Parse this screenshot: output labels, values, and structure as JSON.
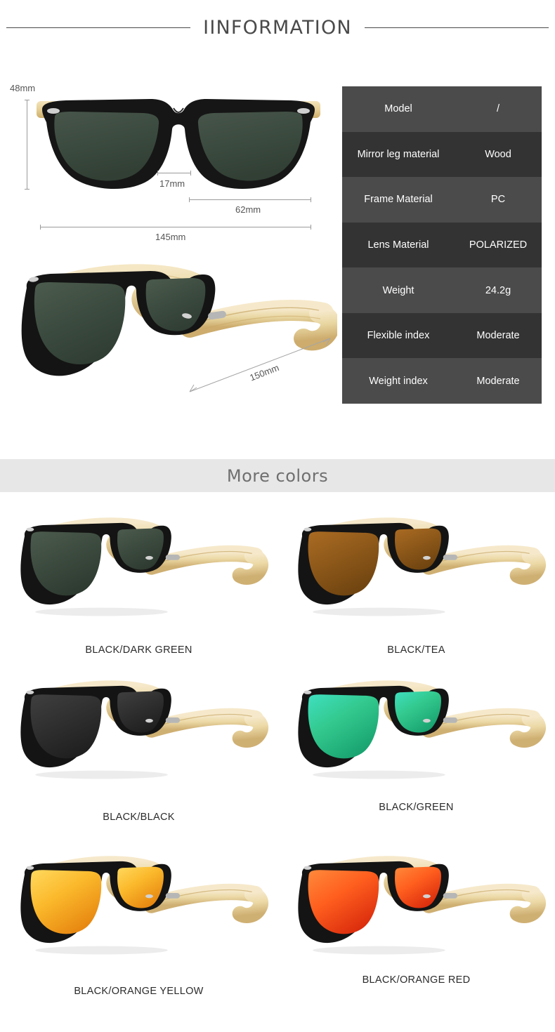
{
  "header": {
    "title": "IINFORMATION"
  },
  "spec_table": {
    "rows": [
      {
        "key": "Model",
        "value": "/"
      },
      {
        "key": "Mirror leg material",
        "value": "Wood"
      },
      {
        "key": "Frame Material",
        "value": "PC"
      },
      {
        "key": "Lens Material",
        "value": "POLARIZED"
      },
      {
        "key": "Weight",
        "value": "24.2g"
      },
      {
        "key": "Flexible index",
        "value": "Moderate"
      },
      {
        "key": "Weight index",
        "value": "Moderate"
      }
    ],
    "row_color_odd": "#4b4b4b",
    "row_color_even": "#333333",
    "text_color": "#ffffff"
  },
  "dimensions": {
    "front": {
      "height": "48mm",
      "bridge": "17mm",
      "lens_width": "62mm",
      "total_width": "145mm"
    },
    "side": {
      "temple_length": "150mm"
    }
  },
  "more_colors": {
    "title": "More colors",
    "band_color": "#e7e7e7",
    "variants": [
      {
        "label": "BLACK/DARK GREEN",
        "lens_color": "#3d4a3f",
        "lens_color2": "#2d3830",
        "temple_color": "#ecd9a6"
      },
      {
        "label": "BLACK/TEA",
        "lens_color": "#9a6220",
        "lens_color2": "#7a4a14",
        "temple_color": "#ecd9a6"
      },
      {
        "label": "BLACK/BLACK",
        "lens_color": "#343434",
        "lens_color2": "#232323",
        "temple_color": "#ecd9a6"
      },
      {
        "label": "BLACK/GREEN",
        "lens_color": "#2fd39a",
        "lens_color2": "#19a884",
        "temple_color": "#ecd9a6"
      },
      {
        "label": "BLACK/ORANGE YELLOW",
        "lens_color": "#fbc23a",
        "lens_color2": "#e88a18",
        "temple_color": "#ecd9a6"
      },
      {
        "label": "BLACK/ORANGE RED",
        "lens_color": "#ff6a22",
        "lens_color2": "#e03010",
        "temple_color": "#ecd9a6"
      }
    ]
  },
  "product_colors": {
    "frame_black": "#1a1a1a",
    "frame_black_light": "#3a3a3a",
    "bamboo_light": "#f0dfb2",
    "bamboo_mid": "#e2c98c",
    "bamboo_dark": "#cbad6a",
    "hinge_silver": "#b9b9b9",
    "main_lens": "#3d4a3f"
  }
}
